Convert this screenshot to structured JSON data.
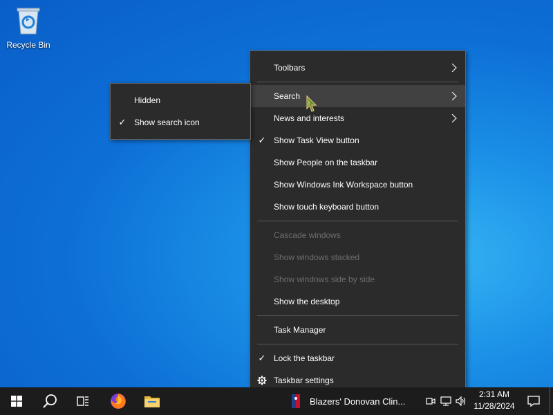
{
  "desktop": {
    "icons": [
      {
        "label": "Recycle Bin",
        "icon": "recycle-bin-icon"
      }
    ]
  },
  "context_menu": {
    "items": [
      {
        "label": "Toolbars",
        "submenu": true
      },
      {
        "label": "Search",
        "submenu": true,
        "highlighted": true
      },
      {
        "label": "News and interests",
        "submenu": true
      },
      {
        "label": "Show Task View button",
        "checked": true
      },
      {
        "label": "Show People on the taskbar"
      },
      {
        "label": "Show Windows Ink Workspace button"
      },
      {
        "label": "Show touch keyboard button"
      },
      {
        "label": "Cascade windows",
        "disabled": true
      },
      {
        "label": "Show windows stacked",
        "disabled": true
      },
      {
        "label": "Show windows side by side",
        "disabled": true
      },
      {
        "label": "Show the desktop"
      },
      {
        "label": "Task Manager"
      },
      {
        "label": "Lock the taskbar",
        "checked": true
      },
      {
        "label": "Taskbar settings",
        "icon": "gear-icon"
      }
    ],
    "check_glyph": "✓"
  },
  "search_submenu": {
    "items": [
      {
        "label": "Hidden"
      },
      {
        "label": "Show search icon",
        "checked": true
      }
    ]
  },
  "taskbar": {
    "apps": [
      {
        "name": "Start",
        "icon": "windows-start-icon"
      },
      {
        "name": "Search",
        "icon": "search-icon"
      },
      {
        "name": "Task View",
        "icon": "task-view-icon"
      },
      {
        "name": "Firefox",
        "icon": "firefox-icon"
      },
      {
        "name": "File Explorer",
        "icon": "file-explorer-icon"
      }
    ],
    "news_text": "Blazers' Donovan Clin...",
    "clock": {
      "time": "2:31 AM",
      "date": "11/28/2024"
    },
    "colors": {
      "background": "#1c1c1c",
      "menu": "#2b2b2b",
      "accent": "#0a5ec8"
    }
  }
}
